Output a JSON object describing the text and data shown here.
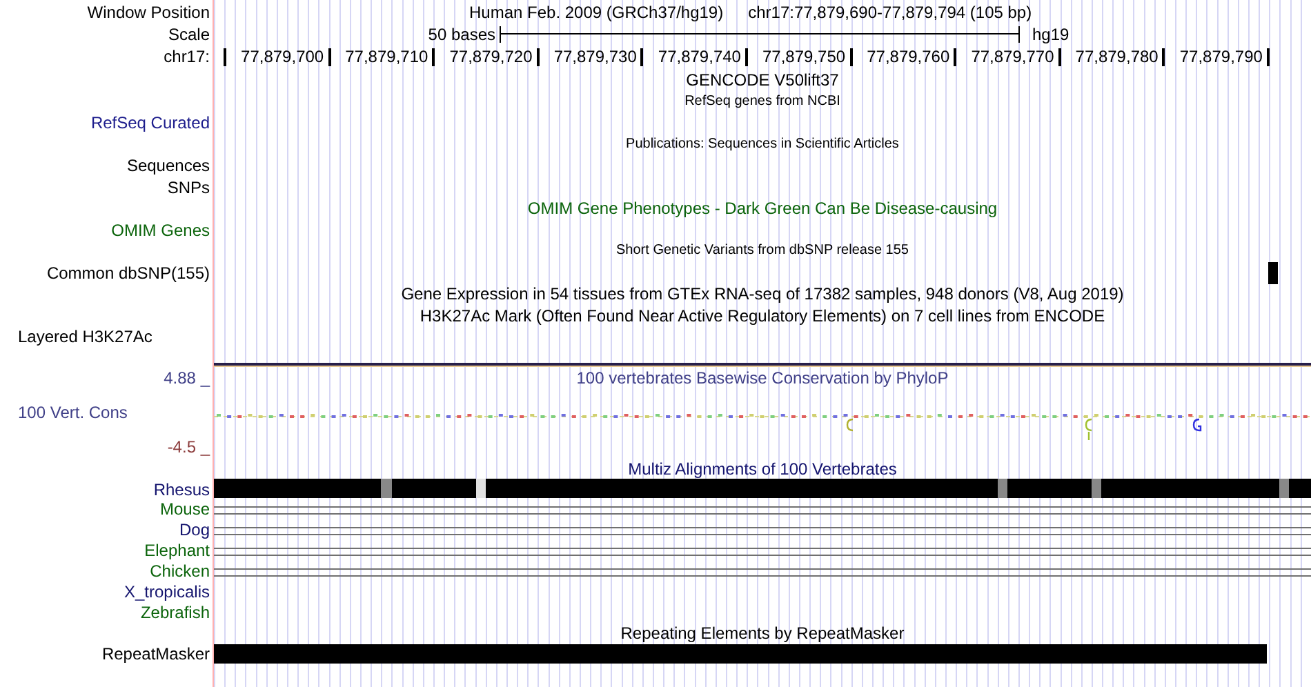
{
  "header": {
    "position_label": "Window Position",
    "assembly": "Human Feb. 2009 (GRCh37/hg19)",
    "position": "chr17:77,879,690-77,879,794 (105 bp)",
    "scale_label": "Scale",
    "scale_text": "50 bases",
    "scale_db": "hg19",
    "chrom_label": "chr17:",
    "ticks": [
      "77,879,700",
      "77,879,710",
      "77,879,720",
      "77,879,730",
      "77,879,740",
      "77,879,750",
      "77,879,760",
      "77,879,770",
      "77,879,780",
      "77,879,790"
    ]
  },
  "tracks": [
    {
      "kind": "title",
      "text": "GENCODE V50lift37",
      "color": "#000000"
    },
    {
      "kind": "note",
      "text": "RefSeq genes from NCBI",
      "color": "#000000"
    },
    {
      "kind": "label",
      "text": "RefSeq Curated",
      "color": "#1c1c8c"
    },
    {
      "kind": "note",
      "text": "Publications: Sequences in Scientific Articles",
      "color": "#000000"
    },
    {
      "kind": "label",
      "text": "Sequences",
      "color": "#000000"
    },
    {
      "kind": "label",
      "text": "SNPs",
      "color": "#000000"
    },
    {
      "kind": "title",
      "text": "OMIM Gene Phenotypes - Dark Green Can Be Disease-causing",
      "color": "#0b640b"
    },
    {
      "kind": "label",
      "text": "OMIM Genes",
      "color": "#0b640b"
    },
    {
      "kind": "note",
      "text": "Short Genetic Variants from dbSNP release 155",
      "color": "#000000"
    },
    {
      "kind": "variants",
      "text": "Common dbSNP(155)",
      "color": "#000000"
    },
    {
      "kind": "title",
      "text": "Gene Expression in 54 tissues from GTEx RNA-seq of 17382 samples, 948 donors (V8, Aug 2019)",
      "color": "#000000"
    },
    {
      "kind": "title",
      "text": "H3K27Ac Mark (Often Found Near Active Regulatory Elements) on 7 cell lines from ENCODE",
      "color": "#000000"
    },
    {
      "kind": "left_label",
      "text": "Layered H3K27Ac",
      "color": "#000000"
    }
  ],
  "conservation": {
    "title": "100 vertebrates Basewise Conservation by PhyloP",
    "label": "100 Vert. Cons",
    "max": "4.88 _",
    "min": "-4.5 _"
  },
  "multiz": {
    "title": "Multiz Alignments of 100 Vertebrates",
    "species": [
      {
        "name": "Rhesus",
        "color": "#14146e",
        "kind": "bar"
      },
      {
        "name": "Mouse",
        "color": "#0b640b",
        "kind": "lines"
      },
      {
        "name": "Dog",
        "color": "#14146e",
        "kind": "lines"
      },
      {
        "name": "Elephant",
        "color": "#0b640b",
        "kind": "lines"
      },
      {
        "name": "Chicken",
        "color": "#0b640b",
        "kind": "lines"
      },
      {
        "name": "X_tropicalis",
        "color": "#14146e",
        "kind": "none"
      },
      {
        "name": "Zebrafish",
        "color": "#0b640b",
        "kind": "none"
      }
    ]
  },
  "repeats": {
    "title": "Repeating Elements by RepeatMasker",
    "label": "RepeatMasker"
  }
}
